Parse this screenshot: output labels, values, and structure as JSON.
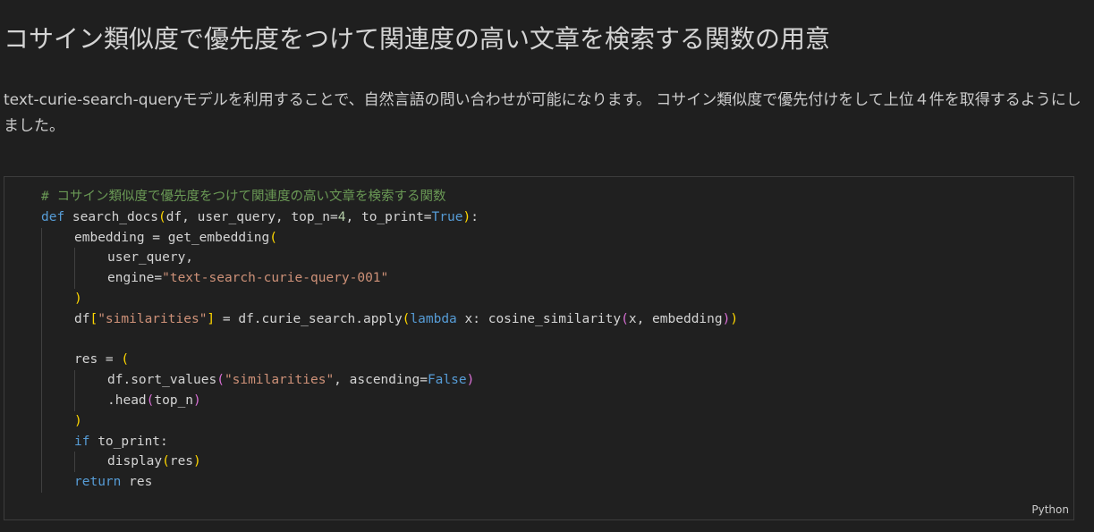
{
  "heading": "コサイン類似度で優先度をつけて関連度の高い文章を検索する関数の用意",
  "paragraph": "text-curie-search-queryモデルを利用することで、自然言語の問い合わせが可能になります。 コサイン類似度で優先付けをして上位４件を取得するようにしました。",
  "code_cell": {
    "language_label": "Python",
    "tokens": {
      "comment": "# コサイン類似度で優先度をつけて関連度の高い文章を検索する関数",
      "def": "def",
      "fn_name": " search_docs",
      "params_a": "df, user_query, top_n=",
      "top_n_default": "4",
      "params_b": ", to_print=",
      "true": "True",
      "colon": ":",
      "embedding_assign": "embedding = get_embedding",
      "user_query_arg": "user_query,",
      "engine_kw": "engine=",
      "engine_val": "\"text-search-curie-query-001\"",
      "df": "df",
      "similarities_str": "\"similarities\"",
      "assign_apply": " = df.curie_search.apply",
      "lambda": "lambda",
      "lambda_rest": " x: cosine_similarity",
      "cos_args": "x, embedding",
      "res_assign": "res = ",
      "sort_values": "df.sort_values",
      "ascending_kw": ", ascending=",
      "false": "False",
      "head": ".head",
      "top_n": "top_n",
      "if": "if",
      "to_print_cond": " to_print:",
      "display": "display",
      "res": "res",
      "return": "return",
      "return_res": " res",
      "open_paren": "(",
      "close_paren": ")",
      "open_bracket": "[",
      "close_bracket": "]"
    }
  }
}
